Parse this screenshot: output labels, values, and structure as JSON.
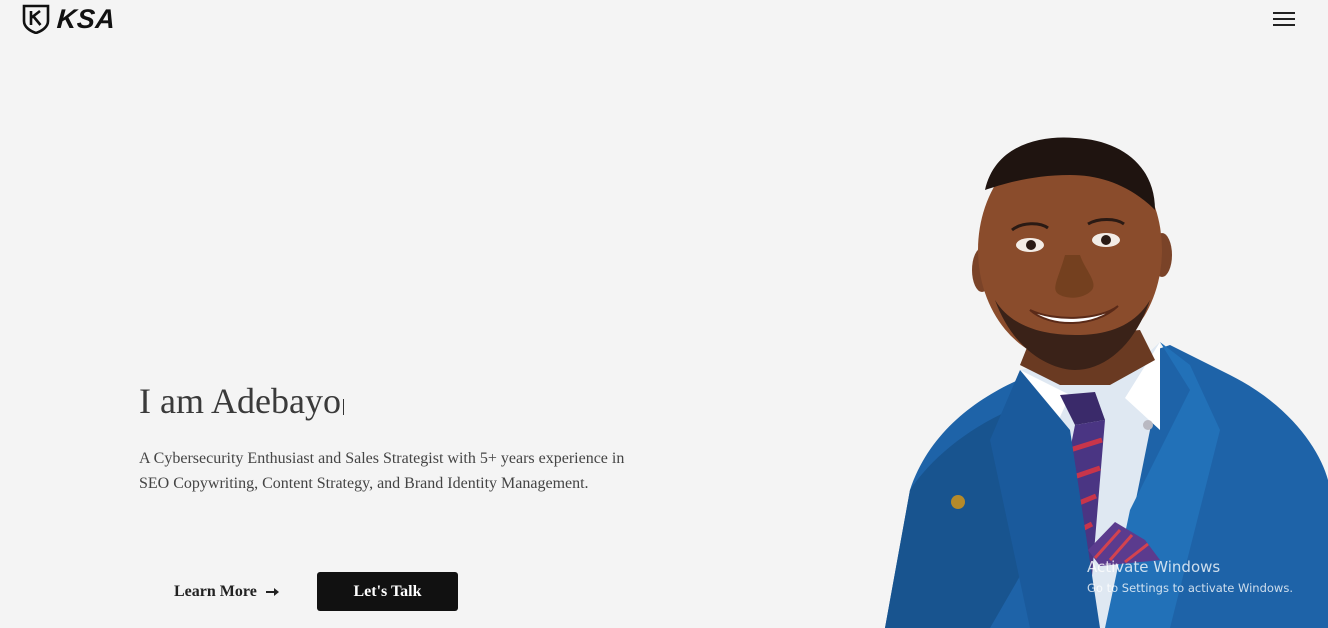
{
  "header": {
    "logo_text": "KSA",
    "logo_mark_letter": "K",
    "menu_icon": "hamburger-menu-icon"
  },
  "hero": {
    "title": "I am Adebayo",
    "description": "A Cybersecurity Enthusiast and Sales Strategist with 5+ years experience in SEO Copywriting, Content Strategy, and Brand Identity Management.",
    "learn_more_label": "Learn More",
    "learn_more_icon": "arrow-right-icon",
    "lets_talk_label": "Let's Talk"
  },
  "portrait": {
    "alt": "Portrait of a smiling man in a blue suit and striped tie"
  },
  "watermark": {
    "title": "Activate Windows",
    "subtitle": "Go to Settings to activate Windows."
  },
  "colors": {
    "background": "#f4f4f4",
    "text": "#3c3c3c",
    "button_bg": "#111111",
    "button_text": "#ffffff",
    "suit": "#1e63a8"
  }
}
